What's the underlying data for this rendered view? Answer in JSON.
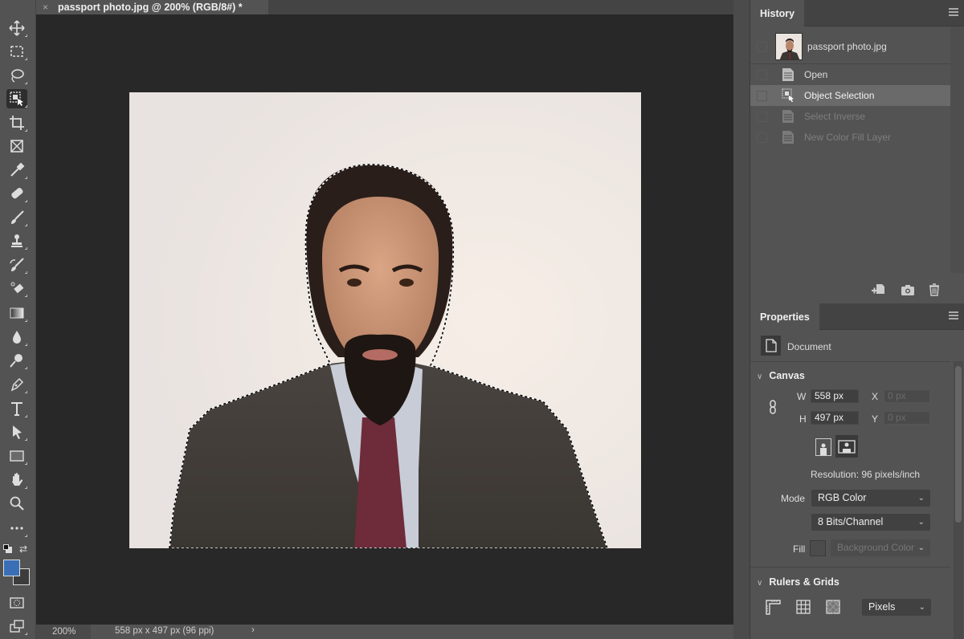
{
  "document_tab": {
    "close_glyph": "×",
    "title": "passport photo.jpg @ 200% (RGB/8#) *"
  },
  "toolbar": {
    "tools": [
      {
        "name": "move-tool"
      },
      {
        "name": "rectangular-marquee-tool"
      },
      {
        "name": "lasso-tool"
      },
      {
        "name": "object-selection-tool",
        "active": true
      },
      {
        "name": "crop-tool"
      },
      {
        "name": "frame-tool"
      },
      {
        "name": "eyedropper-tool"
      },
      {
        "name": "spot-healing-brush-tool"
      },
      {
        "name": "brush-tool"
      },
      {
        "name": "clone-stamp-tool"
      },
      {
        "name": "history-brush-tool"
      },
      {
        "name": "eraser-tool"
      },
      {
        "name": "gradient-tool"
      },
      {
        "name": "blur-tool"
      },
      {
        "name": "dodge-tool"
      },
      {
        "name": "pen-tool"
      },
      {
        "name": "type-tool"
      },
      {
        "name": "path-selection-tool"
      },
      {
        "name": "rectangle-tool"
      },
      {
        "name": "hand-tool"
      },
      {
        "name": "zoom-tool"
      },
      {
        "name": "edit-toolbar"
      }
    ],
    "foreground_color": "#3a6fb5",
    "background_color": "#3c3c3c"
  },
  "status": {
    "zoom": "200%",
    "doc_info": "558 px x 497 px (96 ppi)",
    "arrow": "›"
  },
  "history": {
    "tab": "History",
    "snapshot": "passport photo.jpg",
    "items": [
      {
        "label": "Open",
        "state": "normal"
      },
      {
        "label": "Object Selection",
        "state": "selected"
      },
      {
        "label": "Select Inverse",
        "state": "dim"
      },
      {
        "label": "New Color Fill Layer",
        "state": "dim"
      }
    ]
  },
  "properties": {
    "tab": "Properties",
    "document_label": "Document",
    "canvas": {
      "title": "Canvas",
      "chevron": "∨",
      "w_label": "W",
      "w_value": "558 px",
      "h_label": "H",
      "h_value": "497 px",
      "x_label": "X",
      "x_value": "0 px",
      "y_label": "Y",
      "y_value": "0 px",
      "resolution": "Resolution: 96 pixels/inch",
      "mode_label": "Mode",
      "mode_value": "RGB Color",
      "bits_value": "8 Bits/Channel",
      "fill_label": "Fill",
      "fill_value": "Background Color",
      "caret": "⌄"
    },
    "rulers": {
      "title": "Rulers & Grids",
      "chevron": "∨",
      "units_value": "Pixels",
      "caret": "⌄"
    }
  }
}
